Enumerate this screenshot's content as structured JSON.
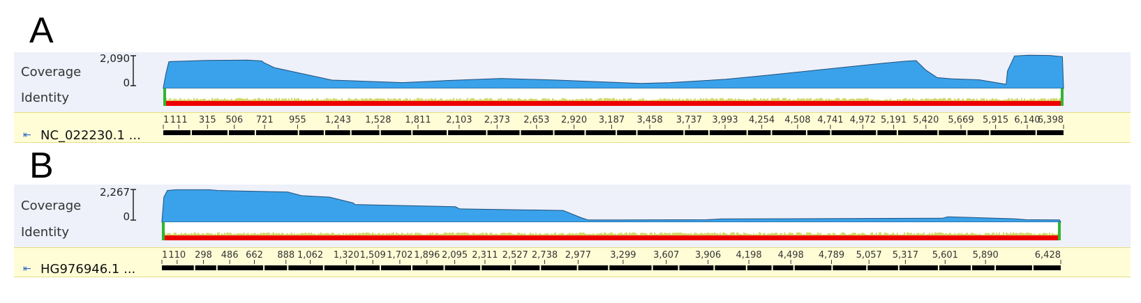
{
  "chart_data": [
    {
      "type": "area",
      "panel": "A",
      "track_labels": {
        "coverage": "Coverage",
        "identity": "Identity"
      },
      "y_ticks": [
        "2,090",
        "0"
      ],
      "ylim": [
        0,
        2090
      ],
      "sequence_name": "NC_022230.1 ...",
      "x_ticks": [
        "1",
        "111",
        "315",
        "506",
        "721",
        "955",
        "1,243",
        "1,528",
        "1,811",
        "2,103",
        "2,373",
        "2,653",
        "2,920",
        "3,187",
        "3,458",
        "3,737",
        "3,993",
        "4,254",
        "4,508",
        "4,741",
        "4,972",
        "5,191",
        "5,420",
        "5,669",
        "5,915",
        "6,140",
        "6,398"
      ],
      "x_range": [
        1,
        6398
      ],
      "coverage": {
        "x": [
          1,
          20,
          40,
          60,
          150,
          300,
          600,
          700,
          715,
          790,
          1200,
          1700,
          2000,
          2400,
          2800,
          3400,
          3600,
          4000,
          4300,
          4700,
          5100,
          5200,
          5280,
          5350,
          5420,
          5500,
          5600,
          5800,
          5990,
          6000,
          6050,
          6150,
          6300,
          6390,
          6398
        ],
        "y": [
          50,
          900,
          1600,
          1620,
          1640,
          1680,
          1700,
          1650,
          1550,
          1250,
          500,
          350,
          470,
          600,
          500,
          300,
          350,
          550,
          800,
          1150,
          1500,
          1580,
          1640,
          1670,
          1100,
          650,
          580,
          520,
          250,
          1050,
          1950,
          2000,
          1980,
          1900,
          20
        ]
      },
      "colors": {
        "coverage": "#3aa2ea",
        "identity_low": "#ee0000",
        "identity_mid": "#b8b800",
        "identity_high": "#2fb52f"
      }
    },
    {
      "type": "area",
      "panel": "B",
      "track_labels": {
        "coverage": "Coverage",
        "identity": "Identity"
      },
      "y_ticks": [
        "2,267",
        "0"
      ],
      "ylim": [
        0,
        2267
      ],
      "sequence_name": "HG976946.1 ...",
      "x_ticks": [
        "1",
        "110",
        "298",
        "486",
        "662",
        "888",
        "1,062",
        "1,320",
        "1,509",
        "1,702",
        "1,896",
        "2,095",
        "2,311",
        "2,527",
        "2,738",
        "2,977",
        "3,299",
        "3,607",
        "3,906",
        "4,198",
        "4,498",
        "4,789",
        "5,057",
        "5,317",
        "5,601",
        "5,890",
        "6,428"
      ],
      "x_range": [
        1,
        6428
      ],
      "coverage": {
        "x": [
          1,
          15,
          40,
          100,
          340,
          400,
          900,
          1000,
          1200,
          1370,
          1380,
          2100,
          2130,
          2870,
          3000,
          3050,
          3900,
          4000,
          5580,
          5620,
          6100,
          6180,
          6420,
          6428
        ],
        "y": [
          50,
          1700,
          2150,
          2200,
          2200,
          2150,
          2050,
          1800,
          1700,
          1300,
          1200,
          1050,
          900,
          800,
          300,
          150,
          170,
          220,
          270,
          370,
          230,
          170,
          150,
          0
        ]
      },
      "colors": {
        "coverage": "#3aa2ea",
        "identity_low": "#ee0000",
        "identity_mid": "#b8b800",
        "identity_high": "#2fb52f"
      }
    }
  ]
}
